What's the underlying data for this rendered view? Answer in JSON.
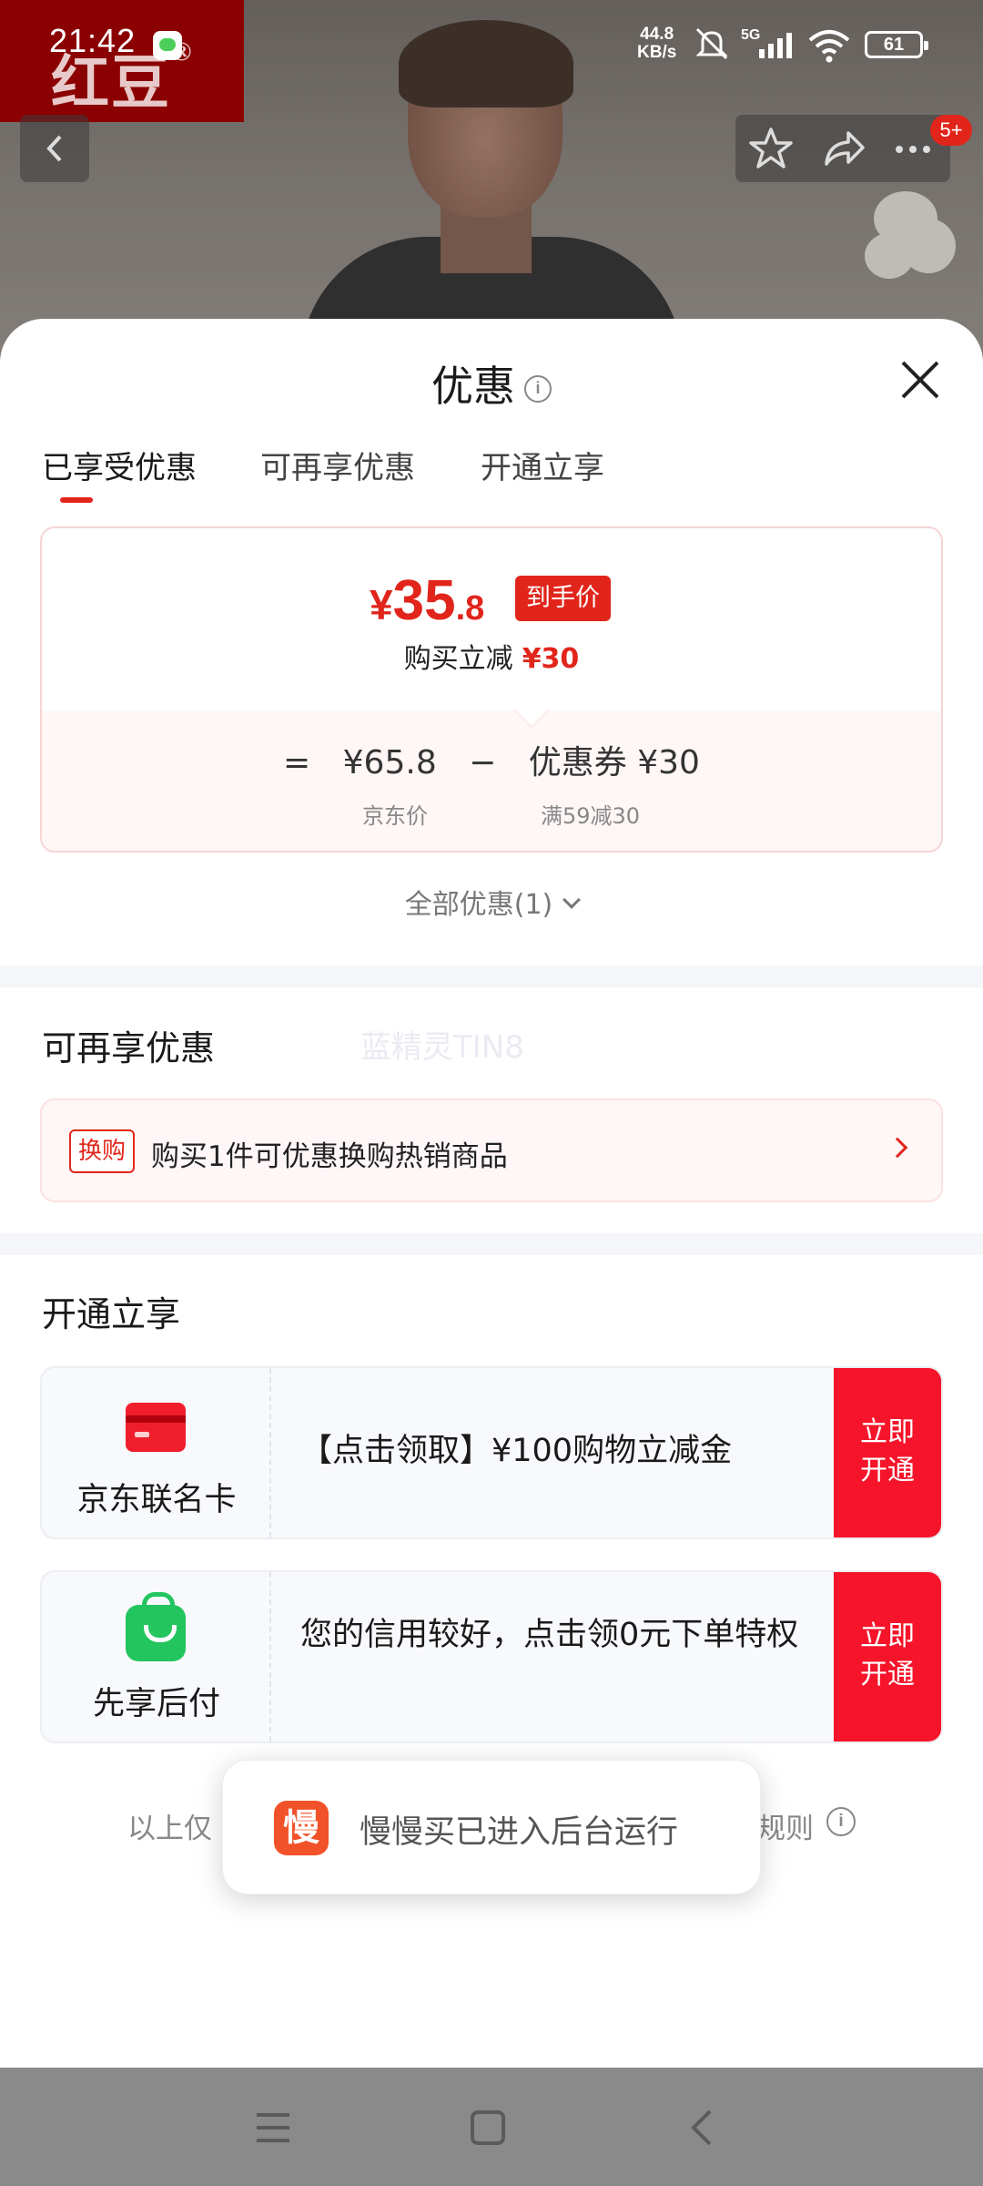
{
  "status_bar": {
    "time": "21:42",
    "net_speed_value": "44.8",
    "net_speed_unit": "KB/s",
    "network": "5G",
    "battery": "61"
  },
  "brand": {
    "logo_text": "红豆",
    "logo_reg": "®"
  },
  "top_bar": {
    "notification_badge": "5+"
  },
  "sheet": {
    "title": "优惠",
    "info_glyph": "i",
    "tabs": [
      {
        "label": "已享受优惠",
        "active": true
      },
      {
        "label": "可再享优惠",
        "active": false
      },
      {
        "label": "开通立享",
        "active": false
      }
    ],
    "price_card": {
      "currency": "¥",
      "final_int": "35",
      "final_dec": ".8",
      "final_tag": "到手价",
      "instant_cut_label": "购买立减",
      "instant_cut_amount": "¥30",
      "equals": "=",
      "jd_price": "¥65.8",
      "minus": "−",
      "coupon": "优惠券 ¥30",
      "jd_price_label": "京东价",
      "coupon_rule": "满59减30"
    },
    "all_discounts": "全部优惠(1)",
    "reuse_section": {
      "title": "可再享优惠",
      "watermark": "蓝精灵TIN8",
      "exchange_tag": "换购",
      "exchange_text": "购买1件可优惠换购热销商品"
    },
    "open_section": {
      "title": "开通立享",
      "offers": [
        {
          "name": "京东联名卡",
          "description": "【点击领取】¥100购物立减金",
          "cta_line1": "立即",
          "cta_line2": "开通"
        },
        {
          "name": "先享后付",
          "description": "您的信用较好，点击领0元下单特权",
          "cta_line1": "立即",
          "cta_line2": "开通"
        }
      ]
    },
    "footer_left": "以上仅",
    "footer_right": "规则"
  },
  "toast": {
    "icon_char": "慢",
    "text": "慢慢买已进入后台运行"
  },
  "colors": {
    "accent": "#e1251b",
    "cta": "#f5142a",
    "green": "#22c55e"
  }
}
